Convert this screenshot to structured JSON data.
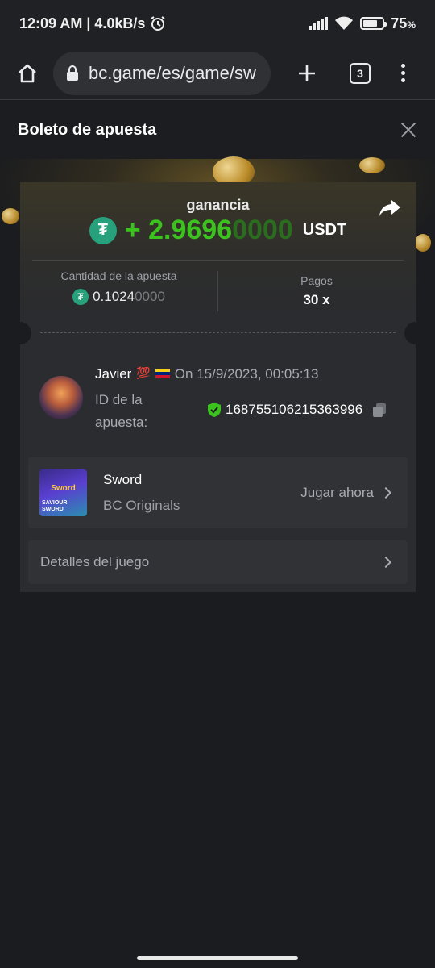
{
  "status_bar": {
    "time_speed": "12:09 AM | 4.0kB/s",
    "battery": "75",
    "battery_unit": "%",
    "battery_level": 0.75
  },
  "browser": {
    "url": "bc.game/es/game/sw",
    "tab_count": "3"
  },
  "modal": {
    "title": "Boleto de apuesta"
  },
  "ticket": {
    "gain_label": "ganancia",
    "gain_prefix": "+ ",
    "gain_main": "2.9696",
    "gain_trailing": "0000",
    "currency": "USDT",
    "bet_amount_label": "Cantidad de la apuesta",
    "bet_amount_main": "0.1024",
    "bet_amount_trailing": "0000",
    "payout_label": "Pagos",
    "payout_value": "30 x"
  },
  "user": {
    "name": "Javier",
    "emoji": "💯",
    "datetime": "On 15/9/2023, 00:05:13",
    "bet_id_label": "ID de la apuesta:",
    "bet_id": "168755106215363996"
  },
  "game": {
    "name": "Sword",
    "provider": "BC Originals",
    "play_label": "Jugar ahora",
    "thumb_title": "Sword",
    "thumb_subtitle": "SAVIOUR SWORD"
  },
  "details": {
    "label": "Detalles del juego"
  },
  "colors": {
    "accent_green": "#3cc21f",
    "tether": "#26a17b"
  }
}
